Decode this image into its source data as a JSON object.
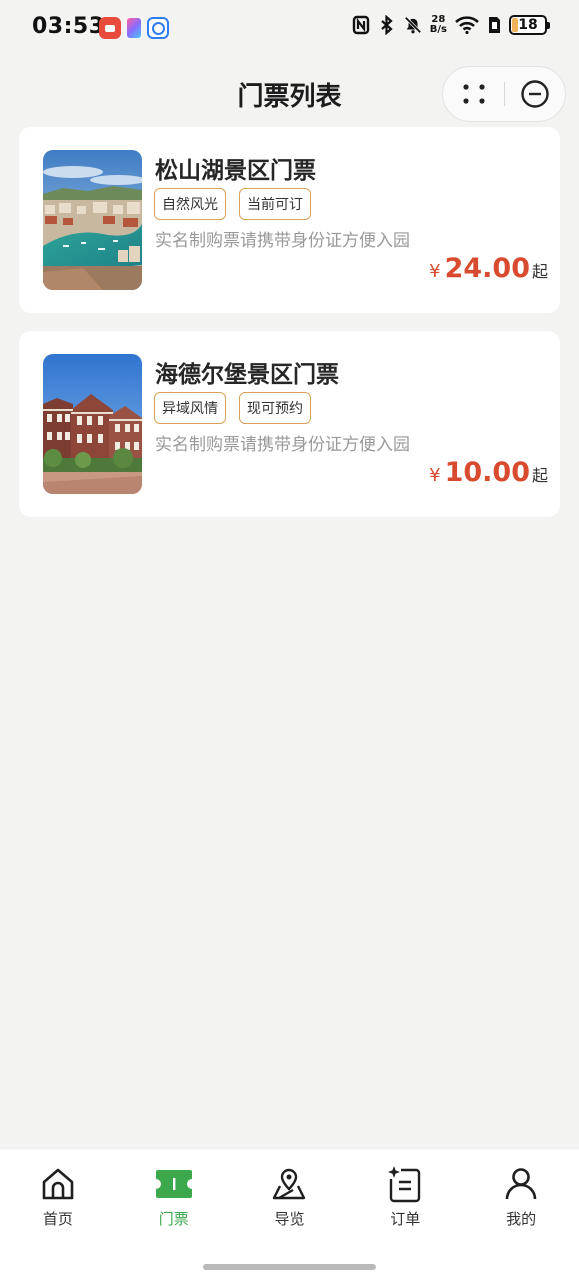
{
  "status_bar": {
    "time": "03:53",
    "network_speed_value": "28",
    "network_speed_unit": "B/s",
    "battery_level": "18",
    "icons": [
      "video-app-icon",
      "gallery-app-icon",
      "browser-app-icon",
      "nfc-icon",
      "bluetooth-icon",
      "mute-icon",
      "wifi-icon",
      "sim-icon",
      "battery-icon"
    ]
  },
  "header": {
    "title": "门票列表",
    "menu_icon": "more-dots-icon",
    "close_icon": "minus-circle-icon"
  },
  "tickets": [
    {
      "name": "松山湖景区门票",
      "tags": [
        "自然风光",
        "当前可订"
      ],
      "notice": "实名制购票请携带身份证方便入园",
      "currency": "¥",
      "price": "24.00",
      "price_suffix": "起",
      "image": "lakeside-city-photo"
    },
    {
      "name": "海德尔堡景区门票",
      "tags": [
        "异域风情",
        "现可预约"
      ],
      "notice": "实名制购票请携带身份证方便入园",
      "currency": "¥",
      "price": "10.00",
      "price_suffix": "起",
      "image": "european-building-photo"
    }
  ],
  "tab_bar": {
    "active": "门票",
    "accent_color": "#3ba84b",
    "tabs": [
      {
        "label": "首页",
        "icon": "home-icon"
      },
      {
        "label": "门票",
        "icon": "ticket-icon"
      },
      {
        "label": "导览",
        "icon": "map-guide-icon"
      },
      {
        "label": "订单",
        "icon": "order-icon"
      },
      {
        "label": "我的",
        "icon": "profile-icon"
      }
    ]
  },
  "colors": {
    "background": "#f3f3f2",
    "price": "#d94b2e",
    "tag_border": "#d9a25a"
  }
}
